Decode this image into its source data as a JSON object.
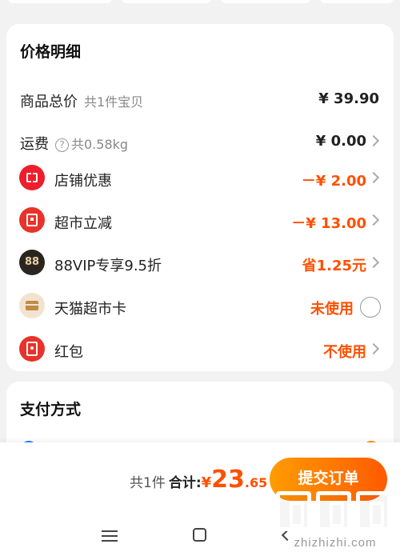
{
  "price_detail": {
    "title": "价格明细",
    "goods_total": {
      "label": "商品总价",
      "sub": "共1件宝贝",
      "value": "¥ 39.90"
    },
    "shipping": {
      "label": "运费",
      "help_glyph": "?",
      "sub": "共0.58kg",
      "value": "¥ 0.00"
    },
    "store_discount": {
      "label": "店铺优惠",
      "value": "－¥ 2.00",
      "icon": "ticket-icon"
    },
    "market_discount": {
      "label": "超市立减",
      "value": "－¥ 13.00",
      "icon": "coupon-icon"
    },
    "vip": {
      "label": "88VIP专享9.5折",
      "badge": "88",
      "value": "省1.25元",
      "icon": "vip-88-icon"
    },
    "tmall_card": {
      "label": "天猫超市卡",
      "value": "未使用",
      "icon": "card-icon"
    },
    "red_packet": {
      "label": "红包",
      "value": "不使用",
      "icon": "red-packet-icon"
    }
  },
  "payment": {
    "title": "支付方式"
  },
  "footer": {
    "count": "共1件",
    "total_label": "合计:",
    "currency": "¥",
    "total_int": "23",
    "total_dec": ".65",
    "submit_label": "提交订单"
  },
  "watermark": {
    "text": "zhizhizhi.com"
  },
  "colors": {
    "accent": "#ff5000",
    "button_start": "#ff9c00",
    "button_end": "#ff5a00",
    "background": "#f2f2f2"
  }
}
